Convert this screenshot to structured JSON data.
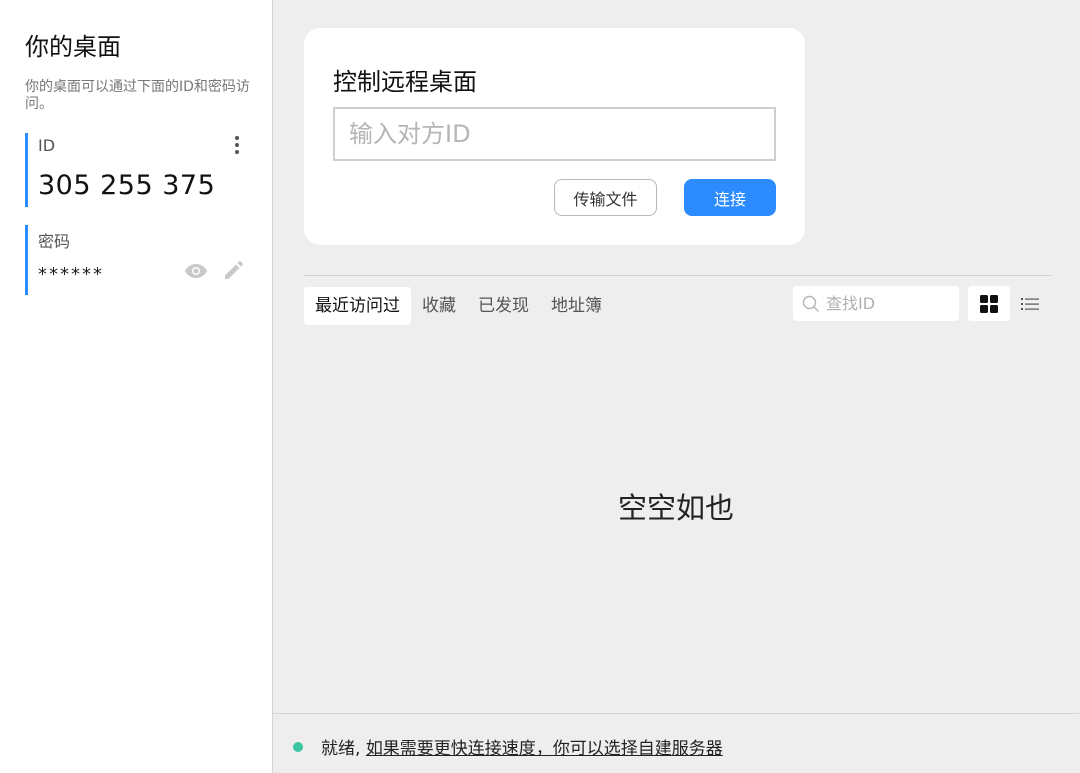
{
  "left": {
    "title": "你的桌面",
    "description": "你的桌面可以通过下面的ID和密码访问。",
    "id_label": "ID",
    "id_value": "305 255 375",
    "password_label": "密码",
    "password_value": "******"
  },
  "card": {
    "title": "控制远程桌面",
    "input_placeholder": "输入对方ID",
    "input_value": "",
    "transfer_button": "传输文件",
    "connect_button": "连接"
  },
  "tabs": [
    {
      "label": "最近访问过",
      "active": true
    },
    {
      "label": "收藏",
      "active": false
    },
    {
      "label": "已发现",
      "active": false
    },
    {
      "label": "地址簿",
      "active": false
    }
  ],
  "search": {
    "placeholder": "查找ID"
  },
  "empty_text": "空空如也",
  "status": {
    "state": "就绪,",
    "link": "如果需要更快连接速度，你可以选择自建服务器"
  },
  "colors": {
    "accent": "#2c8cff",
    "status_dot": "#3cc3a0",
    "background": "#eeeeee"
  },
  "icons": {
    "menu": "kebab-icon",
    "show_password": "eye-icon",
    "edit_password": "pencil-icon",
    "search": "search-icon",
    "grid_view": "grid-icon",
    "list_view": "list-icon"
  }
}
